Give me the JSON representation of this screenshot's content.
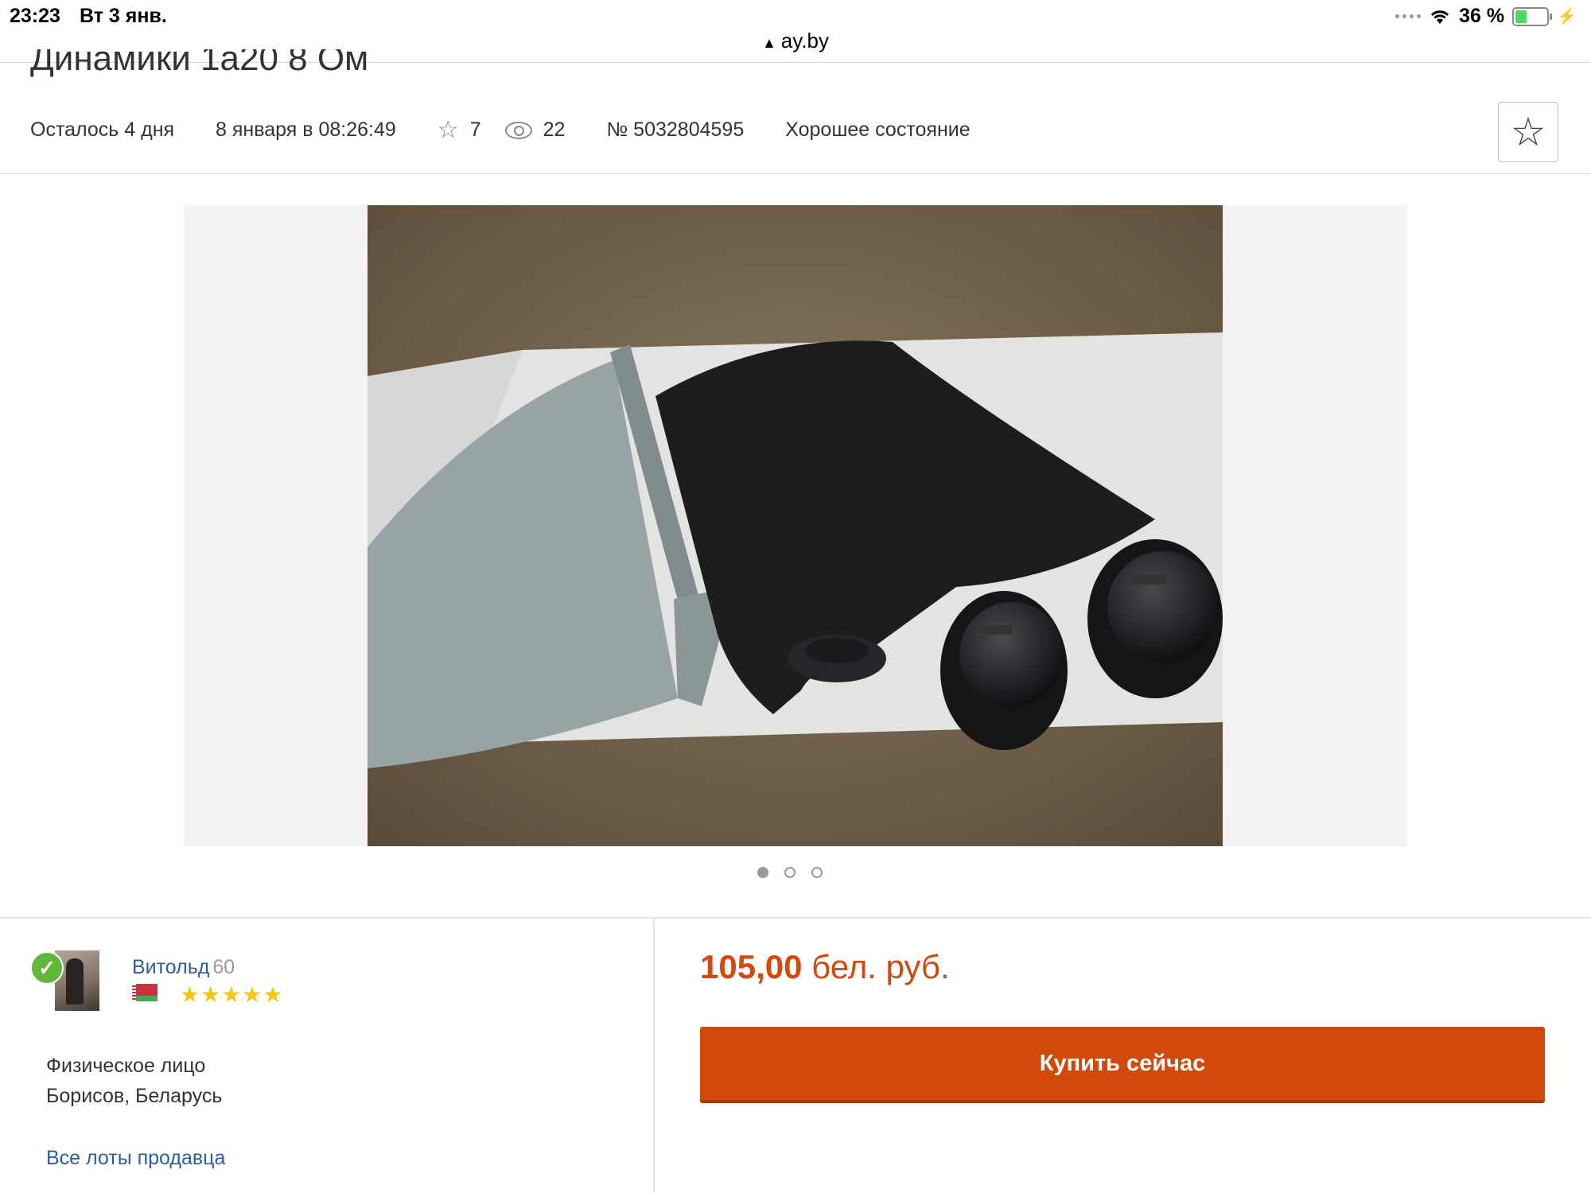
{
  "status_bar": {
    "time": "23:23",
    "date": "Вт 3 янв.",
    "battery": "36 %",
    "battery_level": 0.36,
    "url": "ay.by"
  },
  "lot": {
    "title": "Динамики 1а20 8 Ом",
    "time_left": "Осталось 4 дня",
    "end_date": "8 января в 08:26:49",
    "favorites_count": "7",
    "views_count": "22",
    "lot_number": "№ 5032804595",
    "condition": "Хорошее состояние"
  },
  "gallery": {
    "total_photos": 3,
    "active_index": 0
  },
  "seller": {
    "name": "Витольд",
    "score": "60",
    "rating_stars": "★★★★★",
    "type": "Физическое лицо",
    "location": "Борисов, Беларусь",
    "all_lots_link": "Все лоты продавца"
  },
  "purchase": {
    "price_amount": "105,00",
    "price_currency": "бел. руб.",
    "buy_button": "Купить сейчас"
  },
  "colors": {
    "accent": "#d24a0b",
    "price": "#d4490d",
    "link": "#2a5da8",
    "verified": "#5fb83c"
  }
}
